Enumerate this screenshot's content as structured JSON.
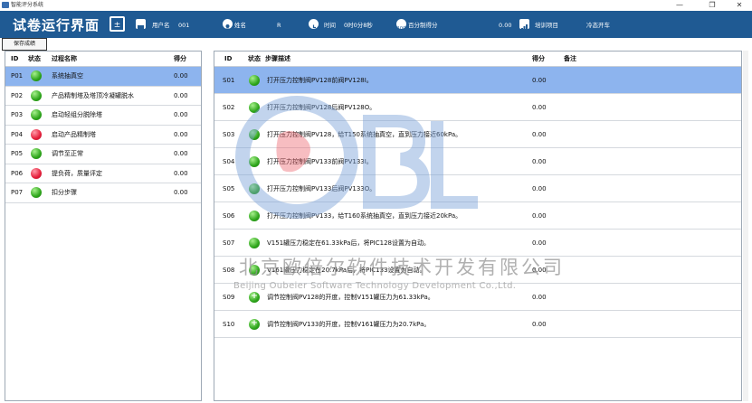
{
  "window": {
    "title": "智能评分系统",
    "controls": [
      "—",
      "❐",
      "✕"
    ]
  },
  "header": {
    "page_title": "试卷运行界面",
    "username_label": "用户名",
    "username_value": "001",
    "name_label": "姓名",
    "name_value": "R",
    "time_label": "时间",
    "time_value": "0时0分8秒",
    "score_label": "百分制得分",
    "score_value": "0.00",
    "project_label": "培训项目",
    "project_value": "冷态开车"
  },
  "toolbar": {
    "save_label": "保存成绩"
  },
  "left_table": {
    "columns": [
      "ID",
      "状态",
      "过程名称",
      "得分"
    ],
    "rows": [
      {
        "id": "P01",
        "status": "green",
        "name": "系统抽真空",
        "score": "0.00",
        "selected": true
      },
      {
        "id": "P02",
        "status": "green",
        "name": "产品精制塔及塔顶冷凝罐脱水",
        "score": "0.00",
        "selected": false
      },
      {
        "id": "P03",
        "status": "green",
        "name": "启动轻组分脱除塔",
        "score": "0.00",
        "selected": false
      },
      {
        "id": "P04",
        "status": "red",
        "name": "启动产品精制塔",
        "score": "0.00",
        "selected": false
      },
      {
        "id": "P05",
        "status": "green",
        "name": "调节至正常",
        "score": "0.00",
        "selected": false
      },
      {
        "id": "P06",
        "status": "red",
        "name": "提负荷，质量评定",
        "score": "0.00",
        "selected": false
      },
      {
        "id": "P07",
        "status": "green",
        "name": "扣分步骤",
        "score": "0.00",
        "selected": false
      }
    ]
  },
  "right_table": {
    "columns": [
      "ID",
      "状态",
      "步骤描述",
      "得分",
      "备注"
    ],
    "rows": [
      {
        "id": "S01",
        "status": "green",
        "desc": "打开压力控制阀PV128前阀PV128I。",
        "score": "0.00",
        "selected": true
      },
      {
        "id": "S02",
        "status": "green",
        "desc": "打开压力控制阀PV128后阀PV128O。",
        "score": "0.00",
        "selected": false
      },
      {
        "id": "S03",
        "status": "green",
        "desc": "打开压力控制阀PV128，给T150系统抽真空，直到压力接近60kPa。",
        "score": "0.00",
        "selected": false
      },
      {
        "id": "S04",
        "status": "green",
        "desc": "打开压力控制阀PV133前阀PV133I。",
        "score": "0.00",
        "selected": false
      },
      {
        "id": "S05",
        "status": "green",
        "desc": "打开压力控制阀PV133后阀PV133O。",
        "score": "0.00",
        "selected": false
      },
      {
        "id": "S06",
        "status": "green",
        "desc": "打开压力控制阀PV133，给T160系统抽真空，直到压力接近20kPa。",
        "score": "0.00",
        "selected": false
      },
      {
        "id": "S07",
        "status": "green",
        "desc": "V151罐压力稳定在61.33kPa后，将PIC128设置为自动。",
        "score": "0.00",
        "selected": false
      },
      {
        "id": "S08",
        "status": "green",
        "desc": "V161罐压力稳定在20.7kPa后，将PIC133设置为自动。",
        "score": "0.00",
        "selected": false
      },
      {
        "id": "S09",
        "status": "plus",
        "desc": "调节控制阀PV128的开度，控制V151罐压力为61.33kPa。",
        "score": "0.00",
        "selected": false
      },
      {
        "id": "S10",
        "status": "plus",
        "desc": "调节控制阀PV133的开度，控制V161罐压力为20.7kPa。",
        "score": "0.00",
        "selected": false
      }
    ]
  },
  "watermark": {
    "logo_text": "OBRL",
    "company_cn": "北京欧倍尔软件技术开发有限公司",
    "company_en": "Beijing Oubeier Software Technology Development Co.,Ltd."
  },
  "colors": {
    "header_bg": "#1f5a93",
    "selected_row": "#8db4ee",
    "status_green": "#2ea51b",
    "status_red": "#e51e3a"
  }
}
